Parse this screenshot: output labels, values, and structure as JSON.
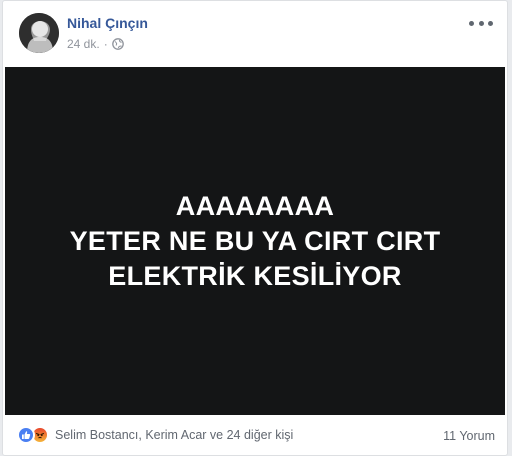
{
  "post": {
    "author": "Nihal Çınçın",
    "time": "24 dk.",
    "separator": "·",
    "privacy_icon": "globe-icon",
    "menu_icon": "more-dots-icon",
    "image_text": {
      "line1": "AAAAAAAA",
      "line2": "YETER NE BU YA CIRT CIRT",
      "line3": "ELEKTRİK KESİLİYOR"
    },
    "reactions": {
      "icons": [
        "like-icon",
        "angry-icon"
      ],
      "names": "Selim Bostancı, Kerim Acar ve 24 diğer kişi"
    },
    "comments": "11 Yorum"
  },
  "colors": {
    "author": "#365899",
    "image_bg": "#141516",
    "meta": "#90949c",
    "like": "#4a7ff2"
  }
}
